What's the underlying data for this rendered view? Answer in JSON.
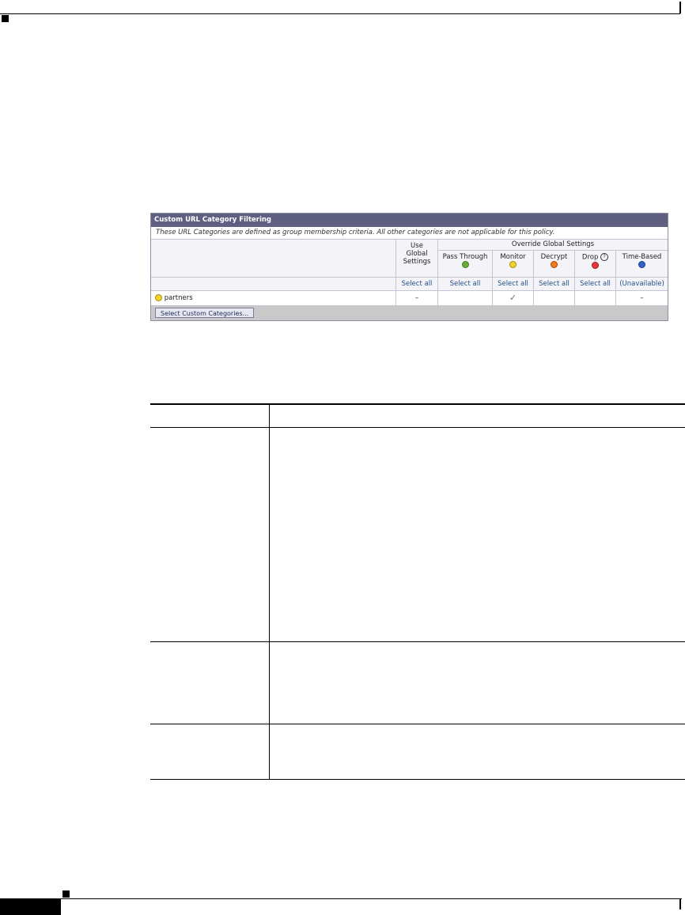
{
  "panel": {
    "title": "Custom URL Category Filtering",
    "note": "These URL Categories are defined as group membership criteria. All other categories are not applicable for this policy.",
    "use_global_header": "Use\nGlobal\nSettings",
    "override_header": "Override Global Settings",
    "columns": [
      {
        "label": "Pass Through",
        "icon": "pass-through-icon",
        "color": "#6aab3a"
      },
      {
        "label": "Monitor",
        "icon": "monitor-icon",
        "color": "#f2d22e"
      },
      {
        "label": "Decrypt",
        "icon": "decrypt-icon",
        "color": "#f07a1a"
      },
      {
        "label": "Drop",
        "icon": "drop-icon",
        "color": "#e23a3a"
      },
      {
        "label": "Time-Based",
        "icon": "time-based-icon",
        "color": "#2f62c8"
      }
    ],
    "select_all": "Select all",
    "unavailable": "(Unavailable)",
    "row": {
      "name": "partners",
      "use_global": "–",
      "monitor_mark": "✓",
      "time_based": "–"
    },
    "button_label": "Select Custom Categories..."
  }
}
